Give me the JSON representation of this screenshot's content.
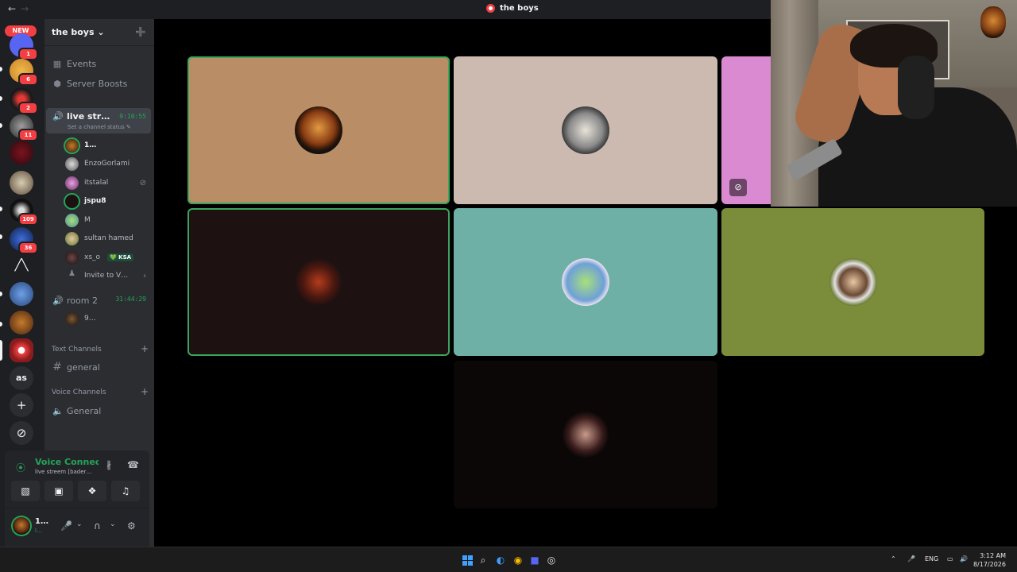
{
  "titlebar": {
    "title": "the boys",
    "back": "←",
    "forward": "→"
  },
  "rail": {
    "new_label": "NEW",
    "badges": [
      "1",
      "6",
      "2",
      "11",
      "109",
      "36"
    ],
    "text_server": "as",
    "add_server": "+",
    "discover": "⊘"
  },
  "guild": {
    "name": "the boys ⌄"
  },
  "channels": {
    "events": "Events",
    "boosts": "Server Boosts",
    "live": {
      "name": "live str…",
      "timer": "9:10:55",
      "status": "Set a channel status ✎"
    },
    "users": [
      {
        "name": "1…",
        "bold": true
      },
      {
        "name": "EnzoGorlami"
      },
      {
        "name": "itstalal"
      },
      {
        "name": "jspu8",
        "bold": true
      },
      {
        "name": "M"
      },
      {
        "name": "sultan hamed"
      },
      {
        "name": "xs_o",
        "tag": "💚 KSA"
      }
    ],
    "invite": "Invite to V…",
    "room2": {
      "name": "room 2",
      "timer": "31:44:29",
      "user": "9…"
    },
    "text_header": "Text Channels",
    "general_text": "general",
    "voice_header": "Voice Channels",
    "general_voice": "General"
  },
  "voice_panel": {
    "status": "Voice Connected",
    "sub": "live streem [bader…",
    "user": "1…",
    "user_status": "l…"
  },
  "tiles": [
    {
      "bg": "#b98e66"
    },
    {
      "bg": "#ccbab0"
    },
    {
      "bg": "#d98ad0"
    },
    {
      "bg": "#1e1111"
    },
    {
      "bg": "#6fb0a6"
    },
    {
      "bg": "#7b8c3b"
    },
    {
      "bg": "#0b0707"
    }
  ],
  "taskbar": {
    "lang": "ENG",
    "time": "3:12 AM",
    "date": "8/17/2026"
  }
}
